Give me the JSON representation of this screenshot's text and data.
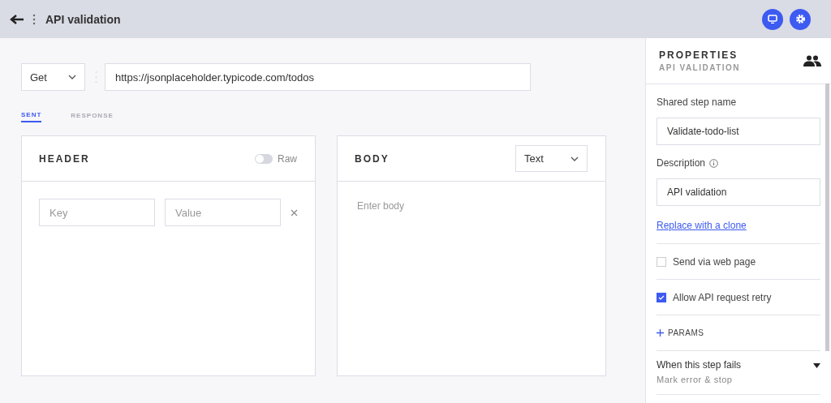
{
  "window": {
    "title": "API validation"
  },
  "request": {
    "method": "Get",
    "url": "https://jsonplaceholder.typicode.com/todos"
  },
  "tabs": [
    {
      "label": "SENT",
      "selected": true
    },
    {
      "label": "RESPONSE",
      "selected": false
    }
  ],
  "header_panel": {
    "title": "HEADER",
    "raw_toggle": {
      "label": "Raw",
      "on": false
    },
    "key_placeholder": "Key",
    "value_placeholder": "Value"
  },
  "body_panel": {
    "title": "BODY",
    "format": "Text",
    "placeholder": "Enter body"
  },
  "properties": {
    "title": "PROPERTIES",
    "subtitle": "API VALIDATION",
    "fields": [
      {
        "label": "Shared step name",
        "value": "Validate-todo-list",
        "info": false
      },
      {
        "label": "Description",
        "value": "API validation",
        "info": true
      }
    ],
    "link": "Replace with a clone",
    "options": [
      {
        "label": "Send via web page",
        "checked": false
      },
      {
        "label": "Allow API request retry",
        "checked": true
      }
    ],
    "params": "PARAMS",
    "on_failure": {
      "label": "When this step fails",
      "value": "Mark error & stop"
    }
  }
}
